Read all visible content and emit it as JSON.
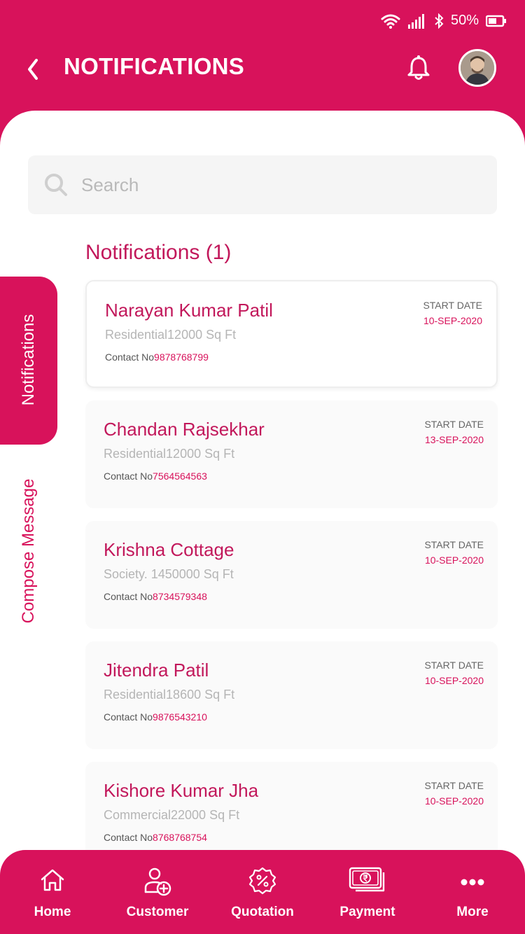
{
  "status_bar": {
    "battery_percent": "50%"
  },
  "header": {
    "title": "NOTIFICATIONS"
  },
  "search": {
    "placeholder": "Search"
  },
  "section": {
    "title": "Notifications (1)"
  },
  "side_tabs": [
    {
      "label": "Notifications",
      "active": true
    },
    {
      "label": "Compose Message",
      "active": false
    }
  ],
  "notifications": [
    {
      "name": "Narayan Kumar Patil",
      "detail": "Residential12000 Sq Ft",
      "contact_label": "Contact No",
      "contact_number": "9878768799",
      "date_label": "START DATE",
      "date": "10-SEP-2020"
    },
    {
      "name": "Chandan Rajsekhar",
      "detail": "Residential12000 Sq Ft",
      "contact_label": "Contact No",
      "contact_number": "7564564563",
      "date_label": "START DATE",
      "date": "13-SEP-2020"
    },
    {
      "name": "Krishna Cottage",
      "detail": "Society. 1450000 Sq Ft",
      "contact_label": "Contact No",
      "contact_number": "8734579348",
      "date_label": "START DATE",
      "date": "10-SEP-2020"
    },
    {
      "name": "Jitendra Patil",
      "detail": "Residential18600 Sq Ft",
      "contact_label": "Contact No",
      "contact_number": "9876543210",
      "date_label": "START DATE",
      "date": "10-SEP-2020"
    },
    {
      "name": "Kishore Kumar Jha",
      "detail": "Commercial22000 Sq Ft",
      "contact_label": "Contact No",
      "contact_number": "8768768754",
      "date_label": "START DATE",
      "date": "10-SEP-2020"
    }
  ],
  "bottom_nav": [
    {
      "label": "Home",
      "icon": "home-icon"
    },
    {
      "label": "Customer",
      "icon": "add-user-icon"
    },
    {
      "label": "Quotation",
      "icon": "percent-badge-icon"
    },
    {
      "label": "Payment",
      "icon": "rupee-note-icon"
    },
    {
      "label": "More",
      "icon": "more-dots-icon"
    }
  ],
  "colors": {
    "primary": "#d8125b",
    "accent_text": "#c2185b",
    "card_bg": "#fafafa",
    "search_bg": "#f5f5f5"
  }
}
